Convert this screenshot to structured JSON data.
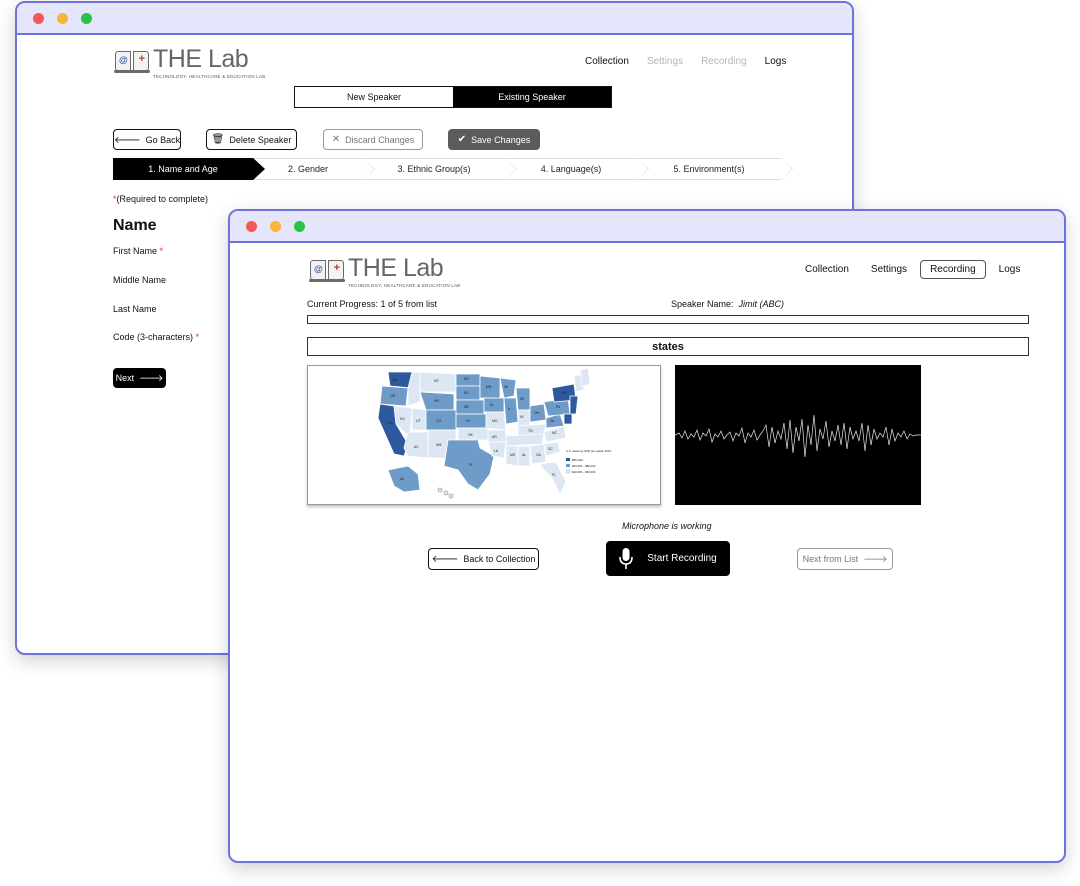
{
  "back_window": {
    "logo": {
      "title": "THE Lab",
      "subtitle": "Technology, Healthcare & Education Lab"
    },
    "nav": [
      {
        "label": "Collection",
        "state": "normal"
      },
      {
        "label": "Settings",
        "state": "disabled"
      },
      {
        "label": "Recording",
        "state": "disabled"
      },
      {
        "label": "Logs",
        "state": "normal"
      }
    ],
    "speaker_toggle": {
      "new": "New Speaker",
      "existing": "Existing Speaker",
      "selected": "existing"
    },
    "actions": {
      "go_back": "Go Back",
      "delete_speaker": "Delete Speaker",
      "discard_changes": "Discard Changes",
      "save_changes": "Save Changes"
    },
    "steps": [
      "1. Name and Age",
      "2. Gender",
      "3. Ethnic Group(s)",
      "4. Language(s)",
      "5. Environment(s)"
    ],
    "required_note": {
      "asterisk": "*",
      "text": "(Required to complete)"
    },
    "section_title": "Name",
    "fields": {
      "first_name": "First Name",
      "middle_name": "Middle Name",
      "last_name": "Last Name",
      "code": "Code (3-characters)",
      "required_mark": "*"
    },
    "next_button": "Next"
  },
  "front_window": {
    "logo": {
      "title": "THE Lab",
      "subtitle": "Technology, Healthcare & Education Lab"
    },
    "nav": [
      {
        "label": "Collection",
        "state": "normal"
      },
      {
        "label": "Settings",
        "state": "normal"
      },
      {
        "label": "Recording",
        "state": "active"
      },
      {
        "label": "Logs",
        "state": "normal"
      }
    ],
    "progress_label": "Current Progress: 1 of 5 from list",
    "progress_fraction": 0.0,
    "speaker_label": "Speaker Name:",
    "speaker_name": "Jimit (ABC)",
    "prompt_word": "states",
    "map": {
      "legend_title": "U.S. states by GDP per capita, 2019",
      "legend_items": [
        "$80,000+",
        "$60,000 – $80,000",
        "$40,000 – $60,000"
      ],
      "colors": {
        "high": "#2d5a9e",
        "mid": "#6f9bc8",
        "low": "#dde7f3"
      }
    },
    "mic_status": "Microphone is working",
    "buttons": {
      "back_to_collection": "Back to Collection",
      "start_recording": "Start Recording",
      "next_from_list": "Next from List"
    }
  },
  "colors": {
    "window_border": "#6e72dc",
    "titlebar": "#e5e6fb"
  }
}
